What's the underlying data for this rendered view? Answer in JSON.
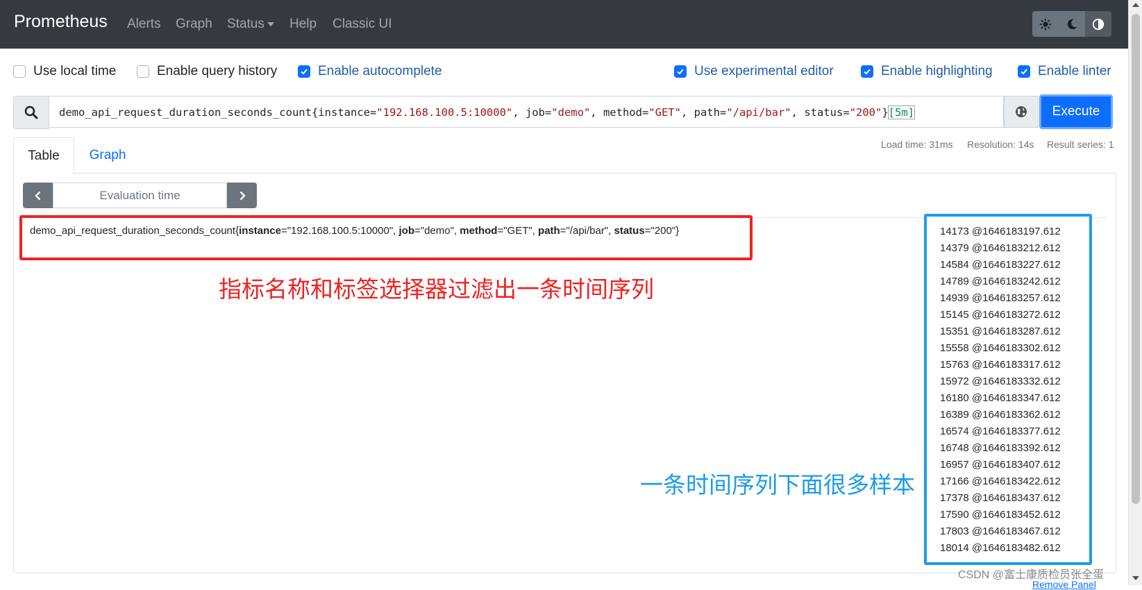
{
  "navbar": {
    "brand": "Prometheus",
    "links": [
      "Alerts",
      "Graph",
      "Status",
      "Help",
      "Classic UI"
    ],
    "theme_icons": [
      "sun-icon",
      "moon-icon",
      "contrast-icon"
    ]
  },
  "options": {
    "use_local_time": {
      "label": "Use local time",
      "checked": false
    },
    "enable_query_history": {
      "label": "Enable query history",
      "checked": false
    },
    "enable_autocomplete": {
      "label": "Enable autocomplete",
      "checked": true
    },
    "use_experimental_editor": {
      "label": "Use experimental editor",
      "checked": true
    },
    "enable_highlighting": {
      "label": "Enable highlighting",
      "checked": true
    },
    "enable_linter": {
      "label": "Enable linter",
      "checked": true
    }
  },
  "query": {
    "metric": "demo_api_request_duration_seconds_count",
    "l1": "instance",
    "v1": "\"192.168.100.5:10000\"",
    "l2": "job",
    "v2": "\"demo\"",
    "l3": "method",
    "v3": "\"GET\"",
    "l4": "path",
    "v4": "\"/api/bar\"",
    "l5": "status",
    "v5": "\"200\"",
    "range": "[5m]",
    "execute_label": "Execute"
  },
  "stats": {
    "load_time": "Load time: 31ms",
    "resolution": "Resolution: 14s",
    "result_series": "Result series: 1"
  },
  "tabs": {
    "table": "Table",
    "graph": "Graph"
  },
  "evaluation_time_placeholder": "Evaluation time",
  "series": {
    "metric": "demo_api_request_duration_seconds_count",
    "labels": [
      {
        "k": "instance",
        "v": "=\"192.168.100.5:10000\", "
      },
      {
        "k": "job",
        "v": "=\"demo\", "
      },
      {
        "k": "method",
        "v": "=\"GET\", "
      },
      {
        "k": "path",
        "v": "=\"/api/bar\", "
      },
      {
        "k": "status",
        "v": "=\"200\""
      }
    ]
  },
  "samples": [
    "14173 @1646183197.612",
    "14379 @1646183212.612",
    "14584 @1646183227.612",
    "14789 @1646183242.612",
    "14939 @1646183257.612",
    "15145 @1646183272.612",
    "15351 @1646183287.612",
    "15558 @1646183302.612",
    "15763 @1646183317.612",
    "15972 @1646183332.612",
    "16180 @1646183347.612",
    "16389 @1646183362.612",
    "16574 @1646183377.612",
    "16748 @1646183392.612",
    "16957 @1646183407.612",
    "17166 @1646183422.612",
    "17378 @1646183437.612",
    "17590 @1646183452.612",
    "17803 @1646183467.612",
    "18014 @1646183482.612"
  ],
  "annotations": {
    "red_text": "指标名称和标签选择器过滤出一条时间序列",
    "blue_text": "一条时间序列下面很多样本",
    "red_color": "#ee2222",
    "blue_color": "#1e9ce6"
  },
  "watermark": "CSDN @富士康质检员张全蛋",
  "remove_panel": "Remove Panel"
}
